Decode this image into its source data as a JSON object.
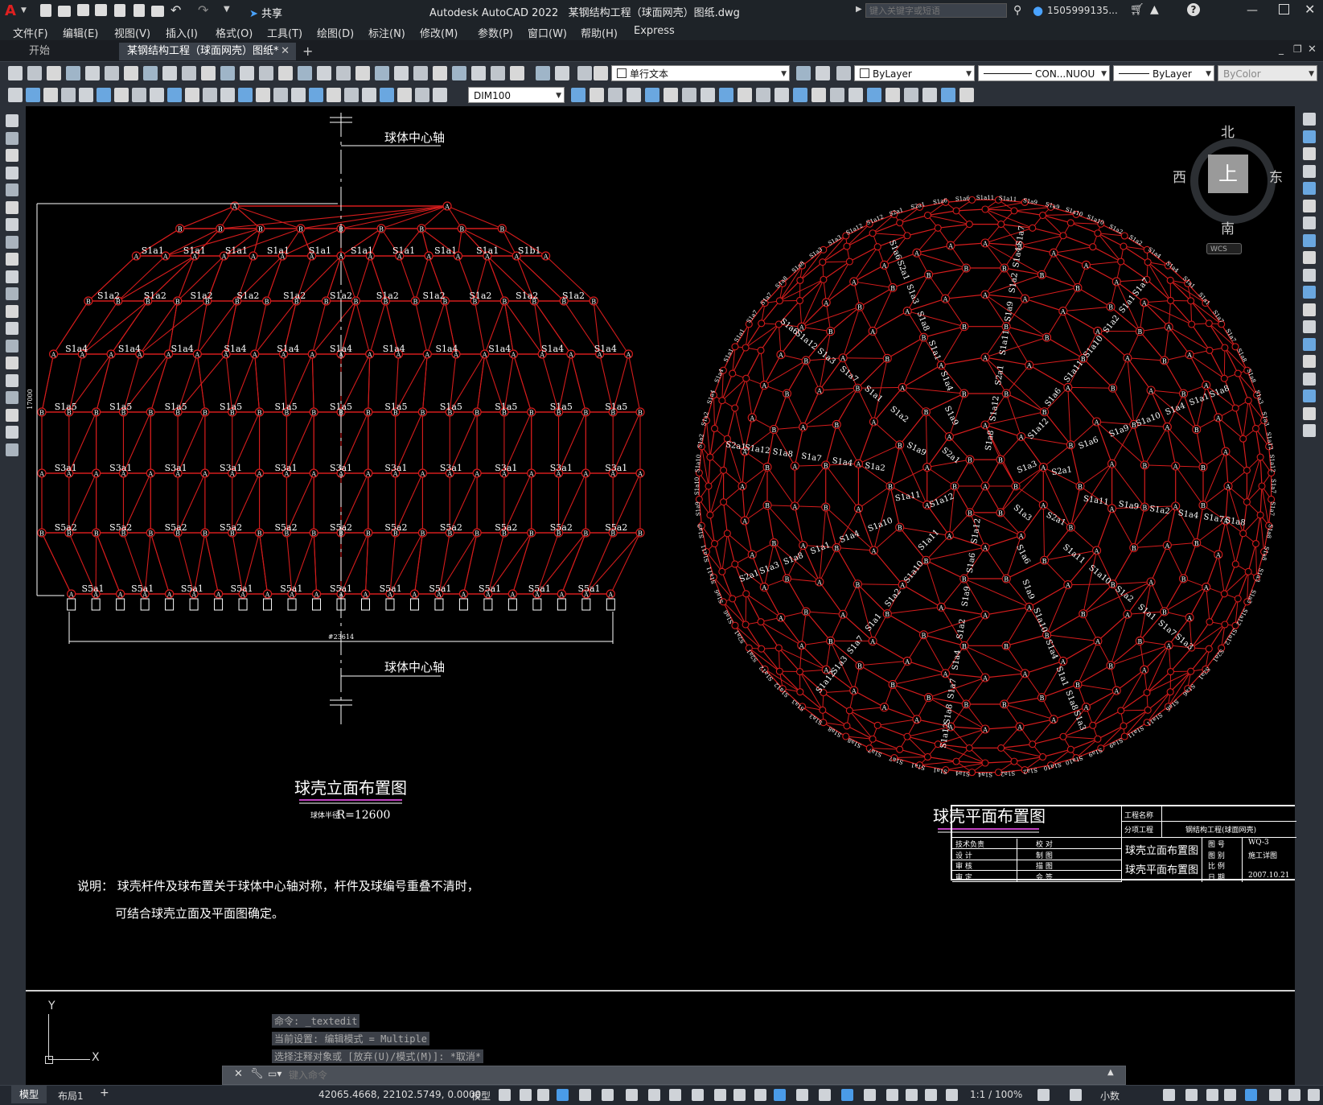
{
  "app": {
    "title": "Autodesk AutoCAD 2022",
    "document": "某钢结构工程（球面网壳）图纸.dwg",
    "search_placeholder": "键入关键字或短语",
    "user": "1505999135...",
    "share": "共享"
  },
  "menu": [
    "文件(F)",
    "编辑(E)",
    "视图(V)",
    "插入(I)",
    "格式(O)",
    "工具(T)",
    "绘图(D)",
    "标注(N)",
    "修改(M)",
    "参数(P)",
    "窗口(W)",
    "帮助(H)",
    "Express"
  ],
  "tabs": {
    "start": "开始",
    "active": "某钢结构工程（球面网壳）图纸*"
  },
  "toolbar": {
    "text_style": "单行文本",
    "layer_color": "ByLayer",
    "linetype": "CON...NUOU",
    "lineweight": "ByLayer",
    "plot_style": "ByColor",
    "dim_style": "DIM100"
  },
  "viewcube": {
    "north": "北",
    "south": "南",
    "east": "东",
    "west": "西",
    "top": "上",
    "wcs": "WCS"
  },
  "drawing": {
    "axis_label_top": "球体中心轴",
    "axis_label_bottom": "球体中心轴",
    "elev_title": "球壳立面布置图",
    "elev_subtitle_small": "球体半径",
    "elev_subtitle_value": "R=12600",
    "plan_title": "球壳平面布置图",
    "width_dim": "#23614",
    "height_dim": "17000",
    "note_line1": "说明： 球壳杆件及球布置关于球体中心轴对称，杆件及球编号重叠不清时，",
    "note_line2": "可结合球壳立面及平面图确定。",
    "elev_labels": {
      "r1": [
        "S1a1",
        "S1a1",
        "S1a1",
        "S1a1",
        "S1a1",
        "S1a1",
        "S1a1",
        "S1a1",
        "S1a1",
        "S1b1"
      ],
      "r2": [
        "S1a2",
        "S1a2",
        "S1a2",
        "S1a2",
        "S1a2",
        "S1a2",
        "S1a2",
        "S1a2",
        "S1a2",
        "S1a2",
        "S1a2"
      ],
      "r3": [
        "S1a4",
        "S1a4",
        "S1a4",
        "S1a4",
        "S1a4",
        "S1a4",
        "S1a4",
        "S1a4",
        "S1a4",
        "S1a4",
        "S1a4"
      ],
      "r4": [
        "S1a5",
        "S1a5",
        "S1a5",
        "S1a5",
        "S1a5",
        "S1a5",
        "S1a5",
        "S1a5",
        "S1a5",
        "S1a5",
        "S1a5"
      ],
      "r5": [
        "S3a1",
        "S3a1",
        "S3a1",
        "S3a1",
        "S3a1",
        "S3a1",
        "S3a1",
        "S3a1",
        "S3a1",
        "S3a1",
        "S3a1"
      ],
      "r6": [
        "S5a2",
        "S5a2",
        "S5a2",
        "S5a2",
        "S5a2",
        "S5a2",
        "S5a2",
        "S5a2",
        "S5a2",
        "S5a2",
        "S5a2"
      ],
      "r7": [
        "S5a1",
        "S5a1",
        "S5a1",
        "S5a1",
        "S5a1",
        "S5a1",
        "S5a1",
        "S5a1",
        "S5a1",
        "S5a1",
        "S5a1"
      ]
    },
    "plan_labels": [
      "S1a7",
      "S1a7",
      "S1a8",
      "S1a8",
      "S1a3",
      "S1a3",
      "S1a12",
      "S1a12",
      "S2a1",
      "S2a1",
      "S1a6",
      "S1a6",
      "S1a11",
      "S1a11",
      "S1a9",
      "S1a9",
      "S1a10",
      "S1a10",
      "S1a2",
      "S1a2",
      "S1a4",
      "S1a4",
      "S1a1",
      "S1a1"
    ]
  },
  "titleblock": {
    "project_name_label": "工程名称",
    "sub_project_label": "分项工程",
    "sub_project_value": "钢结构工程(球面网壳)",
    "roles": [
      [
        "技术负责",
        "校 对"
      ],
      [
        "设 计",
        "制 图"
      ],
      [
        "审 核",
        "描 图"
      ],
      [
        "审 定",
        "会 签"
      ]
    ],
    "drawing_names": [
      "球壳立面布置图",
      "球壳平面布置图"
    ],
    "fields": [
      [
        "图 号",
        "WQ-3"
      ],
      [
        "图 别",
        "施工详图"
      ],
      [
        "比 例",
        ""
      ],
      [
        "日 期",
        "2007.10.21"
      ]
    ]
  },
  "command": {
    "history": [
      "命令: _textedit",
      "当前设置: 编辑模式 = Multiple",
      "选择注释对象或 [放弃(U)/模式(M)]: *取消*"
    ],
    "placeholder": "键入命令"
  },
  "status": {
    "model_tab": "模型",
    "layout_tab": "布局1",
    "coords": "42065.4668, 22102.5749, 0.0000",
    "space": "模型",
    "scale": "1:1 / 100%",
    "units": "小数"
  }
}
